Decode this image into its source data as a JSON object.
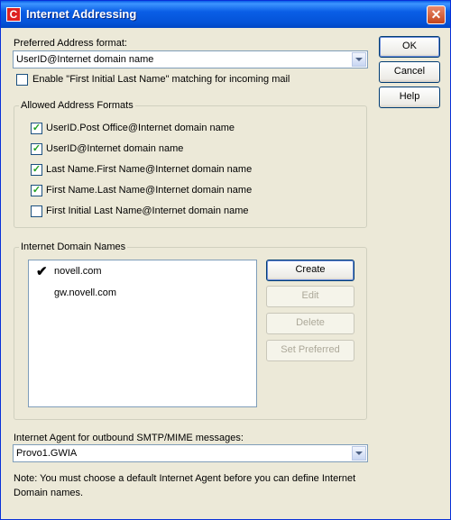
{
  "window": {
    "title": "Internet Addressing",
    "icon": "C"
  },
  "preferred_format": {
    "label": "Preferred Address format:",
    "selected": "UserID@Internet domain name",
    "first_initial_option": {
      "label": "Enable \"First Initial Last Name\" matching for incoming mail",
      "checked": false
    }
  },
  "allowed_formats": {
    "title": "Allowed Address Formats",
    "items": [
      {
        "label": "UserID.Post Office@Internet domain name",
        "checked": true
      },
      {
        "label": "UserID@Internet domain name",
        "checked": true
      },
      {
        "label": "Last Name.First Name@Internet domain name",
        "checked": true
      },
      {
        "label": "First Name.Last Name@Internet domain name",
        "checked": true
      },
      {
        "label": "First Initial Last Name@Internet domain name",
        "checked": false
      }
    ]
  },
  "domain_names": {
    "title": "Internet Domain Names",
    "items": [
      {
        "name": "novell.com",
        "mark": "✔"
      },
      {
        "name": "gw.novell.com",
        "mark": ""
      }
    ],
    "buttons": {
      "create": "Create",
      "edit": "Edit",
      "delete": "Delete",
      "set_preferred": "Set Preferred"
    }
  },
  "agent": {
    "label": "Internet Agent for outbound SMTP/MIME messages:",
    "selected": "Provo1.GWIA"
  },
  "note": {
    "line1": "Note:  You must choose a default Internet Agent before you can define Internet",
    "line2": "Domain names."
  },
  "dialog_buttons": {
    "ok": "OK",
    "cancel": "Cancel",
    "help": "Help"
  }
}
